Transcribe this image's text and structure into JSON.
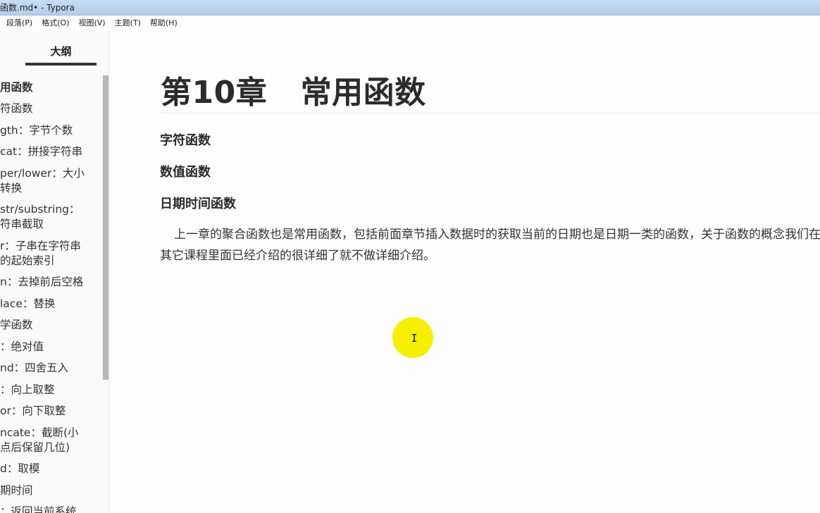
{
  "window": {
    "title": "函数.md• - Typora"
  },
  "menu": {
    "items": [
      "段落(P)",
      "格式(O)",
      "视图(V)",
      "主题(T)",
      "帮助(H)"
    ]
  },
  "sidebar": {
    "tab_label": "大纲",
    "items": [
      {
        "text": "用函数",
        "level": 1
      },
      {
        "text": "符函数",
        "level": 2
      },
      {
        "text": "gth：字节个数",
        "level": 3
      },
      {
        "text": "cat：拼接字符串",
        "level": 3
      },
      {
        "text": "per/lower：大小\n转换",
        "level": 3
      },
      {
        "text": "str/substring：\n符串截取",
        "level": 3
      },
      {
        "text": "r：子串在字符串\n的起始索引",
        "level": 3
      },
      {
        "text": "n：去掉前后空格",
        "level": 3
      },
      {
        "text": "lace：替换",
        "level": 3
      },
      {
        "text": "学函数",
        "level": 2
      },
      {
        "text": "：绝对值",
        "level": 3
      },
      {
        "text": "nd：四舍五入",
        "level": 3
      },
      {
        "text": "：向上取整",
        "level": 3
      },
      {
        "text": "or：向下取整",
        "level": 3
      },
      {
        "text": "ncate：截断(小\n点后保留几位)",
        "level": 3
      },
      {
        "text": "d：取模",
        "level": 3
      },
      {
        "text": "期时间",
        "level": 2
      },
      {
        "text": "：返回当前系统",
        "level": 3
      }
    ]
  },
  "document": {
    "title": "第10章   常用函数",
    "headings": [
      "字符函数",
      "数值函数",
      "日期时间函数"
    ],
    "paragraph": "上一章的聚合函数也是常用函数，包括前面章节插入数据时的获取当前的日期也是日期一类的函数，关于函数的概念我们在其它课程里面已经介绍的很详细了就不做详细介绍。"
  },
  "cursor": {
    "glyph": "I",
    "highlight_color": "#f4f000"
  }
}
